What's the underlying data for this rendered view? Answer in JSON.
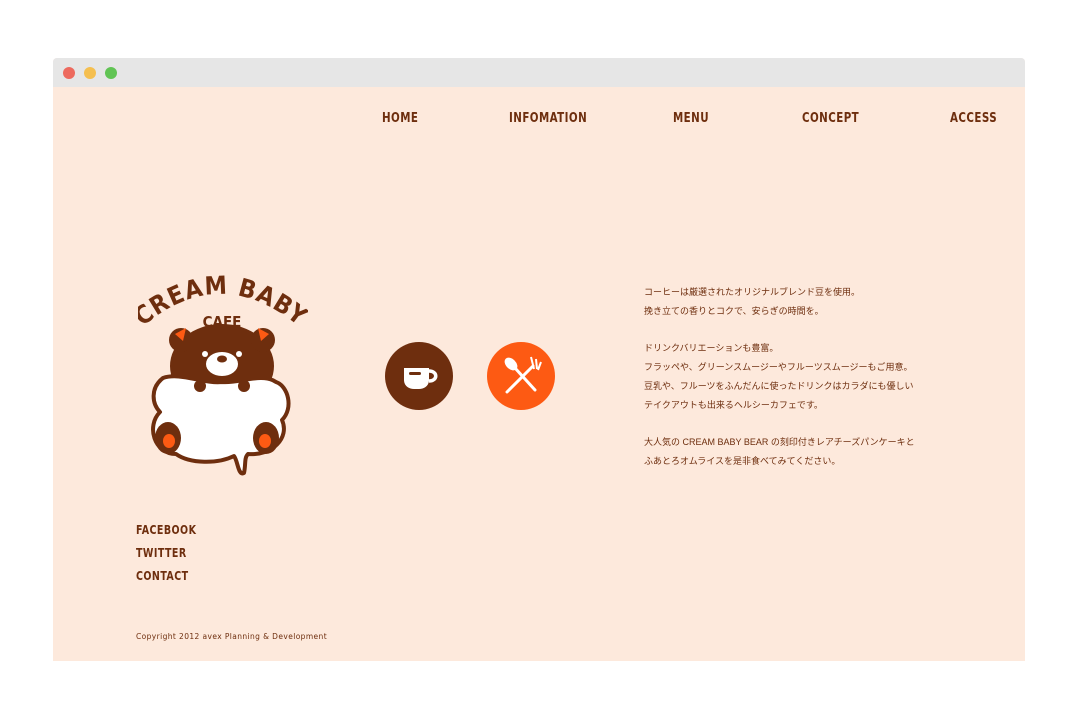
{
  "colors": {
    "page_bg": "#fde9dc",
    "brand_brown": "#6e2e0e",
    "accent_orange": "#fd5a13",
    "titlebar": "#e6e6e6"
  },
  "nav": [
    {
      "label": "HOME"
    },
    {
      "label": "INFOMATION"
    },
    {
      "label": "MENU"
    },
    {
      "label": "CONCEPT"
    },
    {
      "label": "ACCESS"
    }
  ],
  "logo": {
    "line1": "CREAM BABY",
    "line2": "CAFE",
    "icon": "bear-mascot-icon"
  },
  "feature_icons": [
    "coffee-cup-icon",
    "fork-spoon-icon"
  ],
  "about": {
    "paragraphs": [
      [
        "コーヒーは厳選されたオリジナルブレンド豆を使用。",
        "挽き立ての香りとコクで、安らぎの時間を。"
      ],
      [
        "ドリンクバリエーションも豊富。",
        "フラッペや、グリーンスムージーやフルーツスムージーもご用意。",
        "豆乳や、フルーツをふんだんに使ったドリンクはカラダにも優しい",
        "テイクアウトも出来るヘルシーカフェです。"
      ],
      [
        "大人気の CREAM BABY BEAR の刻印付きレアチーズパンケーキと",
        "ふあとろオムライスを是非食べてみてください。"
      ]
    ]
  },
  "side_links": [
    {
      "label": "FACEBOOK"
    },
    {
      "label": "TWITTER"
    },
    {
      "label": "CONTACT"
    }
  ],
  "footer": {
    "copyright": "Copyright 2012 avex Planning & Development"
  }
}
